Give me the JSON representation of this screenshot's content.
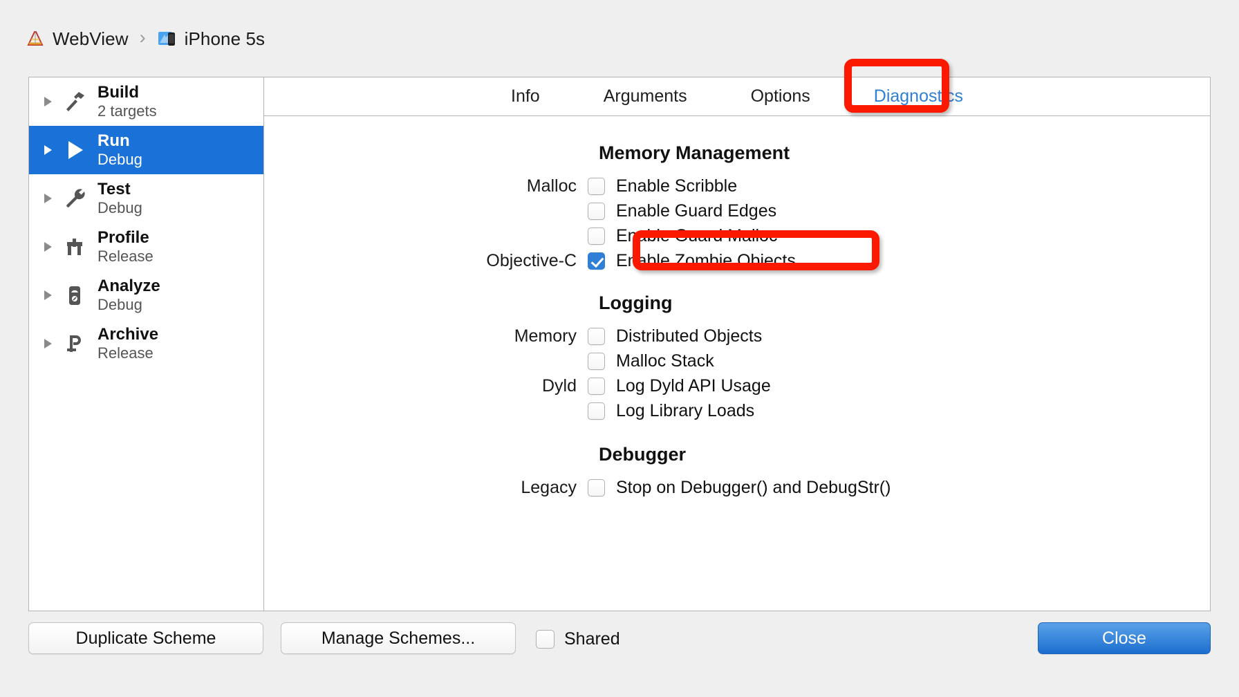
{
  "breadcrumb": {
    "project": "WebView",
    "separator": "›",
    "device": "iPhone 5s",
    "project_icon": "xcode-icon",
    "device_icon": "simulator-icon"
  },
  "sidebar": {
    "items": [
      {
        "name": "Build",
        "sub": "2 targets",
        "icon": "hammer-icon",
        "selected": false
      },
      {
        "name": "Run",
        "sub": "Debug",
        "icon": "play-icon",
        "selected": true
      },
      {
        "name": "Test",
        "sub": "Debug",
        "icon": "wrench-icon",
        "selected": false
      },
      {
        "name": "Profile",
        "sub": "Release",
        "icon": "caliper-icon",
        "selected": false
      },
      {
        "name": "Analyze",
        "sub": "Debug",
        "icon": "meter-icon",
        "selected": false
      },
      {
        "name": "Archive",
        "sub": "Release",
        "icon": "clamp-icon",
        "selected": false
      }
    ]
  },
  "tabs": [
    {
      "label": "Info",
      "active": false
    },
    {
      "label": "Arguments",
      "active": false
    },
    {
      "label": "Options",
      "active": false
    },
    {
      "label": "Diagnostics",
      "active": true
    }
  ],
  "diagnostics": {
    "sections": [
      {
        "title": "Memory Management",
        "rows": [
          {
            "label": "Malloc",
            "text": "Enable Scribble",
            "checked": false
          },
          {
            "label": "",
            "text": "Enable Guard Edges",
            "checked": false
          },
          {
            "label": "",
            "text": "Enable Guard Malloc",
            "checked": false
          },
          {
            "label": "Objective-C",
            "text": "Enable Zombie Objects",
            "checked": true
          }
        ]
      },
      {
        "title": "Logging",
        "rows": [
          {
            "label": "Memory",
            "text": "Distributed Objects",
            "checked": false
          },
          {
            "label": "",
            "text": "Malloc Stack",
            "checked": false
          },
          {
            "label": "Dyld",
            "text": "Log Dyld API Usage",
            "checked": false
          },
          {
            "label": "",
            "text": "Log Library Loads",
            "checked": false
          }
        ]
      },
      {
        "title": "Debugger",
        "rows": [
          {
            "label": "Legacy",
            "text": "Stop on Debugger() and DebugStr()",
            "checked": false
          }
        ]
      }
    ]
  },
  "bottom": {
    "duplicate_label": "Duplicate Scheme",
    "manage_label": "Manage Schemes...",
    "shared_label": "Shared",
    "shared_checked": false,
    "close_label": "Close"
  },
  "annotations": {
    "accent_color": "#fb1900",
    "targets": [
      "Diagnostics",
      "Enable Zombie Objects"
    ]
  },
  "colors": {
    "selection_blue": "#1a72d8",
    "tab_active_blue": "#2f7fd6",
    "checkbox_checked": "#2f7fd6",
    "window_background": "#efefef",
    "panel_background": "#ffffff"
  }
}
